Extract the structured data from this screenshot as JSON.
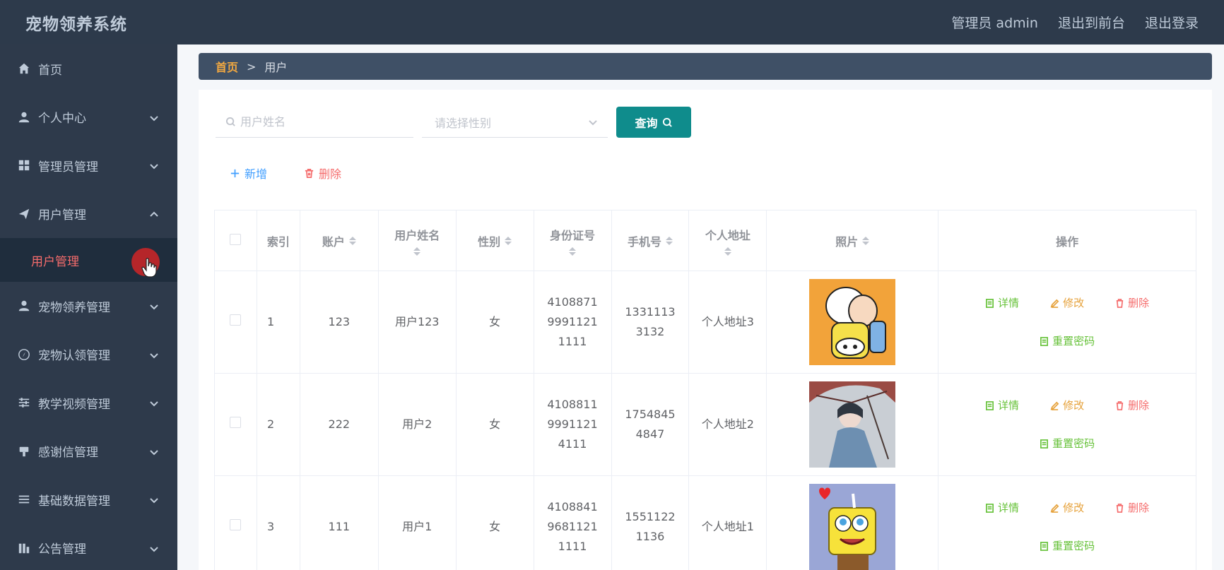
{
  "app": {
    "title": "宠物领养系统"
  },
  "header": {
    "admin_label": "管理员 admin",
    "to_front": "退出到前台",
    "logout": "退出登录"
  },
  "sidebar": {
    "items": [
      {
        "label": "首页",
        "icon": "home-icon"
      },
      {
        "label": "个人中心",
        "icon": "user-icon"
      },
      {
        "label": "管理员管理",
        "icon": "grid-icon"
      },
      {
        "label": "用户管理",
        "icon": "send-icon"
      },
      {
        "label": "宠物领养管理",
        "icon": "user-icon"
      },
      {
        "label": "宠物认领管理",
        "icon": "compass-icon"
      },
      {
        "label": "教学视频管理",
        "icon": "sliders-icon"
      },
      {
        "label": "感谢信管理",
        "icon": "stamp-icon"
      },
      {
        "label": "基础数据管理",
        "icon": "list-icon"
      },
      {
        "label": "公告管理",
        "icon": "chart-icon"
      }
    ],
    "active_sub": "用户管理"
  },
  "breadcrumb": {
    "home": "首页",
    "separator": ">",
    "current": "用户"
  },
  "search": {
    "name_placeholder": "用户姓名",
    "gender_placeholder": "请选择性别",
    "query_label": "查询"
  },
  "actions": {
    "add_label": "新增",
    "delete_label": "删除"
  },
  "table": {
    "headers": {
      "index": "索引",
      "account": "账户",
      "name": "用户姓名",
      "gender": "性别",
      "id_card": "身份证号",
      "phone": "手机号",
      "address": "个人地址",
      "photo": "照片",
      "ops": "操作"
    },
    "rows": [
      {
        "index": "1",
        "account": "123",
        "name": "用户123",
        "gender": "女",
        "id_card": "410887199911211111",
        "phone": "13311133132",
        "address": "个人地址3"
      },
      {
        "index": "2",
        "account": "222",
        "name": "用户2",
        "gender": "女",
        "id_card": "410881199911214111",
        "phone": "17548454847",
        "address": "个人地址2"
      },
      {
        "index": "3",
        "account": "111",
        "name": "用户1",
        "gender": "女",
        "id_card": "410884196811211111",
        "phone": "15511221136",
        "address": "个人地址1"
      }
    ],
    "ops": {
      "detail": "详情",
      "edit": "修改",
      "remove": "删除",
      "reset": "重置密码"
    }
  }
}
